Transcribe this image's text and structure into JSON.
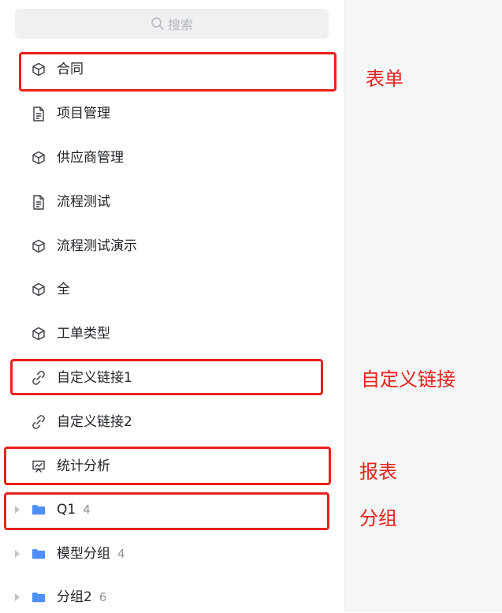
{
  "search": {
    "placeholder": "搜索"
  },
  "items": [
    {
      "label": "合同",
      "icon": "cube-icon"
    },
    {
      "label": "项目管理",
      "icon": "document-icon"
    },
    {
      "label": "供应商管理",
      "icon": "cube-icon"
    },
    {
      "label": "流程测试",
      "icon": "document-icon"
    },
    {
      "label": "流程测试演示",
      "icon": "cube-icon"
    },
    {
      "label": "全",
      "icon": "cube-icon"
    },
    {
      "label": "工单类型",
      "icon": "cube-icon"
    },
    {
      "label": "自定义链接1",
      "icon": "link-icon"
    },
    {
      "label": "自定义链接2",
      "icon": "link-icon"
    },
    {
      "label": "统计分析",
      "icon": "report-icon"
    }
  ],
  "groups": [
    {
      "label": "Q1",
      "count": "4"
    },
    {
      "label": "模型分组",
      "count": "4"
    },
    {
      "label": "分组2",
      "count": "6"
    }
  ],
  "annotations": {
    "form": "表单",
    "custom_link": "自定义链接",
    "report": "报表",
    "group": "分组"
  },
  "colors": {
    "annotation_red": "#e8211a",
    "folder_blue": "#4d8ef7",
    "search_bg": "#eef0f2"
  }
}
